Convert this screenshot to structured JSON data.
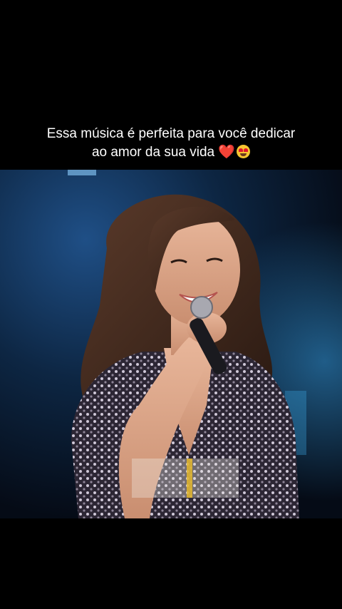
{
  "caption": {
    "line1": "Essa música é perfeita para você dedicar",
    "line2_text": "ao amor da sua vida",
    "emoji_heart": "❤️"
  },
  "video": {
    "description_icon": "performer-video"
  },
  "colors": {
    "background": "#000000",
    "caption_text": "#ffffff",
    "stage_blue": "#0d2a4a"
  }
}
